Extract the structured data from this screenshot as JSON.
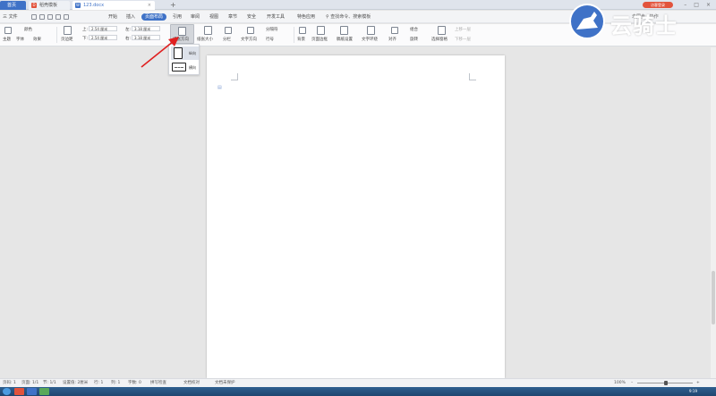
{
  "tabs": [
    {
      "label": "首页"
    },
    {
      "label": "稻壳模板"
    },
    {
      "label": "123.docx"
    }
  ],
  "login_label": "访客登录",
  "menu": {
    "file": "三 文件",
    "items": [
      "开始",
      "插入",
      "页面布局",
      "引用",
      "审阅",
      "视图",
      "章节",
      "安全",
      "开发工具",
      "特色应用"
    ],
    "active": "页面布局",
    "search": "查找命令、搜索模板",
    "cloud": "未同步 · 协作"
  },
  "ribbon": {
    "theme": "主题",
    "fonts": "字体",
    "effects": "效果",
    "colors": "颜色",
    "margins": "页边距",
    "top_label": "上:",
    "top_value": "2.54 厘米",
    "bottom_label": "下:",
    "bottom_value": "2.54 厘米",
    "left_label": "左:",
    "left_value": "3.18 厘米",
    "right_label": "右:",
    "right_value": "3.18 厘米",
    "orientation": "纸张方向",
    "size": "纸张大小",
    "columns": "分栏",
    "text_direction": "文字方向",
    "breaks": "分隔符",
    "line_numbers": "行号",
    "background": "背景",
    "page_border": "页面边框",
    "wrap_text": "稿纸设置",
    "text_wrap": "文字环绕",
    "align": "对齐",
    "rotate": "旋转",
    "group": "组合",
    "selection_pane": "选择窗格",
    "bring_forward": "上移一层",
    "send_backward": "下移一层"
  },
  "orientation_menu": {
    "portrait": "纵向",
    "landscape": "横向"
  },
  "status": {
    "page": "页码: 1",
    "pages": "页面: 1/1",
    "section": "节: 1/1",
    "setting": "设置值: 2厘米",
    "row": "行: 1",
    "col": "列: 1",
    "words": "字数: 0",
    "spell": "拼写检查",
    "doc_check": "文档校对",
    "protect": "文档未保护",
    "zoom": "100%"
  },
  "clock": "9:19",
  "watermark": "云骑士",
  "colors": {
    "accent": "#3f72c7",
    "arrow": "#e02020",
    "login": "#e2533c"
  }
}
